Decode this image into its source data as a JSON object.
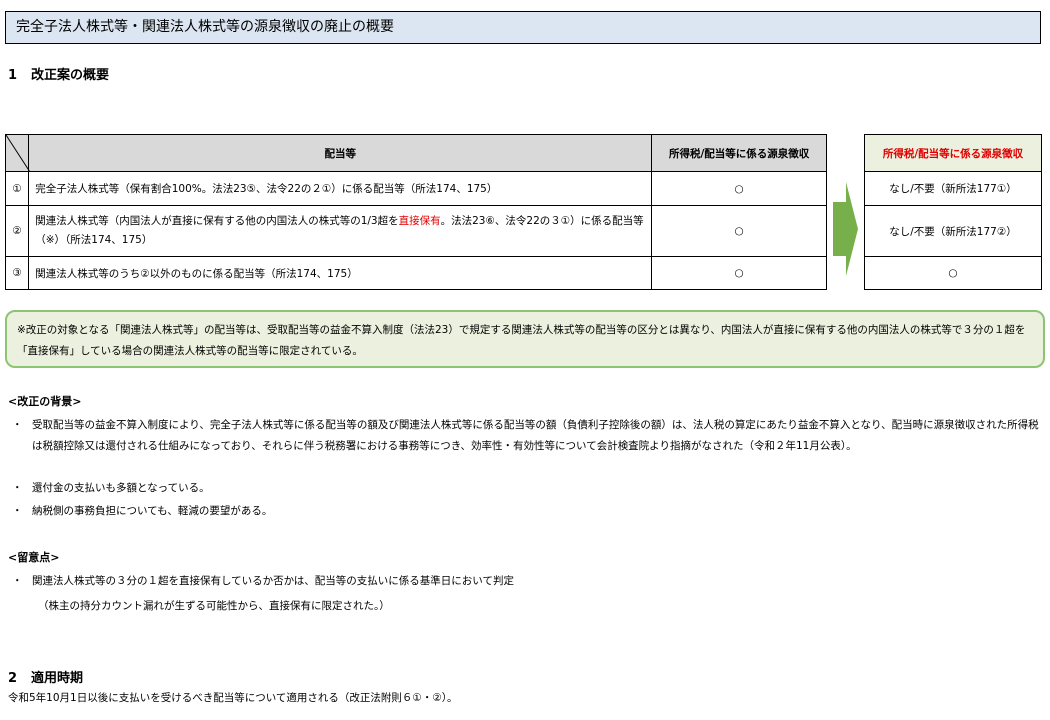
{
  "title": "完全子法人株式等・関連法人株式等の源泉徴収の廃止の概要",
  "section1": {
    "num": "1",
    "label": "改正案の概要"
  },
  "table": {
    "header_dividend": "配当等",
    "header_current": "所得税/配当等に係る源泉徴収",
    "header_new": "所得税/配当等に係る源泉徴収",
    "rows": [
      {
        "idx": "①",
        "text": "完全子法人株式等（保有割合100%。法法23⑤、法令22の２①）に係る配当等（所法174、175）",
        "current": "○",
        "new": "なし/不要（新所法177①）"
      },
      {
        "idx": "②",
        "text_a": "関連法人株式等（内国法人が直接に保有する他の内国法人の株式等の1/3超を",
        "text_red": "直接保有",
        "text_b": "。法法23⑥、法令22の３①）に係る配当等（※）（所法174、175）",
        "current": "○",
        "new": "なし/不要（新所法177②）"
      },
      {
        "idx": "③",
        "text": "関連法人株式等のうち②以外のものに係る配当等（所法174、175）",
        "current": "○",
        "new": "○"
      }
    ]
  },
  "note": "※改正の対象となる「関連法人株式等」の配当等は、受取配当等の益金不算入制度（法法23）で規定する関連法人株式等の配当等の区分とは異なり、内国法人が直接に保有する他の内国法人の株式等で３分の１超を「直接保有」している場合の関連法人株式等の配当等に限定されている。",
  "background": {
    "heading": "<改正の背景>",
    "bullets": [
      "受取配当等の益金不算入制度により、完全子法人株式等に係る配当等の額及び関連法人株式等に係る配当等の額（負債利子控除後の額）は、法人税の算定にあたり益金不算入となり、配当時に源泉徴収された所得税は税額控除又は還付される仕組みになっており、それらに伴う税務署における事務等につき、効率性・有効性等について会計検査院より指摘がなされた（令和２年11月公表）。",
      "還付金の支払いも多額となっている。",
      "納税側の事務負担についても、軽減の要望がある。"
    ]
  },
  "notes": {
    "heading": "<留意点>",
    "bullet": "関連法人株式等の３分の１超を直接保有しているか否かは、配当等の支払いに係る基準日において判定",
    "sub": "（株主の持分カウント漏れが生ずる可能性から、直接保有に限定された。）"
  },
  "section2": {
    "num": "2",
    "label": "適用時期"
  },
  "footer": "令和5年10月1日以後に支払いを受けるべき配当等について適用される（改正法附則６①・②）。",
  "colors": {
    "title_bg": "#dce6f2",
    "header_gray": "#d9d9d9",
    "green_bg": "#ebf1de",
    "green_border": "#8dc472",
    "arrow": "#77b04a",
    "red": "#e00000"
  }
}
